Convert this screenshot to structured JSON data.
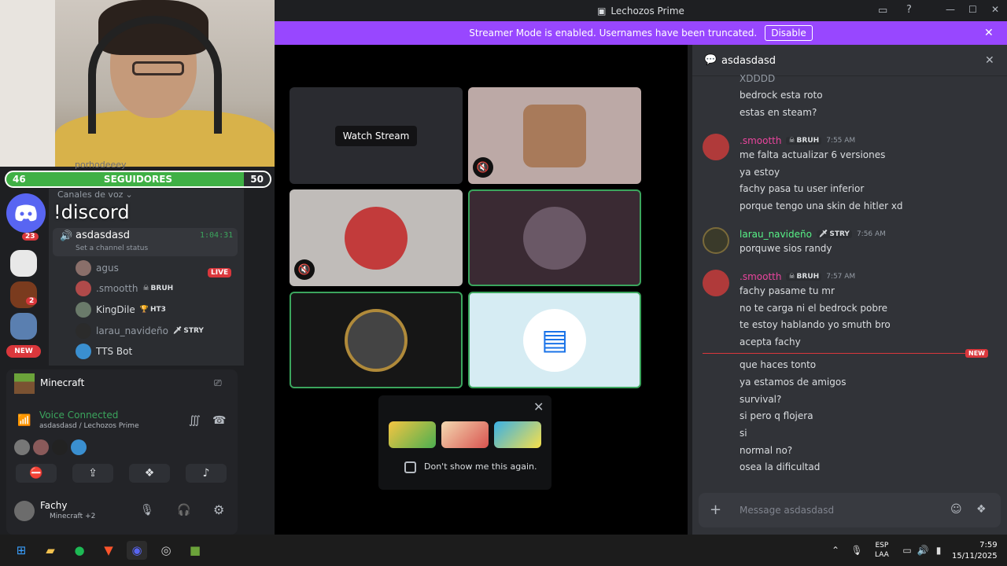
{
  "window": {
    "title": "Lechozos Prime"
  },
  "streamer_bar": {
    "text": "Streamer Mode is enabled. Usernames have been truncated.",
    "disable_label": "Disable"
  },
  "overlay": {
    "channel_hint": "porhodeeey",
    "followers_label": "SEGUIDORES",
    "followers_current": "46",
    "followers_goal": "50",
    "command": "!discord"
  },
  "rail": {
    "badge1": "23",
    "badge2": "2",
    "new_label": "NEW"
  },
  "sidebar": {
    "category": "Canales de voz",
    "voice_channel": {
      "name": "asdasdasd",
      "timer": "1:04:31",
      "status": "Set a channel status"
    },
    "members": [
      {
        "name": "agus",
        "live": "LIVE"
      },
      {
        "name": ".smootth",
        "tag": "BRUH"
      },
      {
        "name": "KingDile",
        "tag": "HT3"
      },
      {
        "name": "larau_navideño",
        "tag": "STRY"
      },
      {
        "name": "TTS Bot"
      }
    ]
  },
  "activity": {
    "game": "Minecraft"
  },
  "voice": {
    "status": "Voice Connected",
    "channel": "asdasdasd / Lechozos Prime"
  },
  "user": {
    "name": "Fachy",
    "activity": "Minecraft +2"
  },
  "stage": {
    "watch_label": "Watch Stream"
  },
  "popup": {
    "checkbox_label": "Don't show me this again."
  },
  "chat": {
    "channel": "asdasdasd",
    "top_messages": [
      "XDDDD",
      "bedrock esta roto",
      "estas en steam?"
    ],
    "groups": [
      {
        "user": ".smootth",
        "tag": "BRUH",
        "time": "7:55 AM",
        "lines": [
          "me falta actualizar 6 versiones",
          "ya  estoy",
          "fachy pasa tu user inferior",
          "porque tengo una skin de hitler xd"
        ]
      },
      {
        "user": "larau_navideño",
        "tag": "STRY",
        "time": "7:56 AM",
        "lines": [
          "porquwe sios randy"
        ]
      },
      {
        "user": ".smootth",
        "tag": "BRUH",
        "time": "7:57 AM",
        "lines": [
          "fachy pasame tu mr",
          "no te carga ni el bedrock pobre",
          "te estoy hablando yo smuth bro",
          "acepta fachy"
        ]
      }
    ],
    "new_label": "NEW",
    "after_new": [
      "que haces tonto",
      "ya estamos de amigos",
      "survival?",
      "si pero q flojera",
      "si",
      "normal no?",
      "osea la dificultad"
    ],
    "input_placeholder": "Message asdasdasd"
  },
  "taskbar": {
    "lang1": "ESP",
    "lang2": "LAA",
    "time": "7:59",
    "date": "15/11/2025"
  },
  "colors": {
    "accent": "#5865f2",
    "streamer": "#9847ff",
    "green": "#3ba55d",
    "pink": "#eb459e",
    "green_name": "#57f287"
  }
}
